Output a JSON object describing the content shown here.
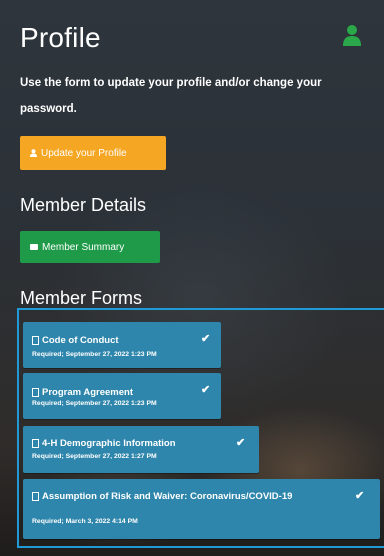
{
  "header": {
    "title": "Profile",
    "user_icon": "user-icon"
  },
  "intro": {
    "text": "Use the form to update your profile and/or change your password."
  },
  "update_button": {
    "label": "Update your Profile",
    "icon": "user-icon",
    "color": "#f5a623"
  },
  "member_details": {
    "heading": "Member Details"
  },
  "summary_button": {
    "label": "Member Summary",
    "icon": "card-icon",
    "color": "#1e9a48"
  },
  "member_forms": {
    "heading": "Member Forms",
    "items": [
      {
        "title": "Code of Conduct",
        "status": "Required; September 27, 2022 1:23 PM",
        "completed": true
      },
      {
        "title": "Program Agreement",
        "status": "Required; September 27, 2022 1:23 PM",
        "completed": true
      },
      {
        "title": "4-H Demographic Information",
        "status": "Required; September 27, 2022 1:27 PM",
        "completed": true
      },
      {
        "title": "Assumption of Risk and Waiver: Coronavirus/COVID-19",
        "status": "Required; March 3, 2022 4:14 PM",
        "completed": true
      }
    ]
  },
  "colors": {
    "card": "#2f86ac",
    "highlight_border": "#1f9ad6",
    "user_icon": "#2aa84a"
  }
}
